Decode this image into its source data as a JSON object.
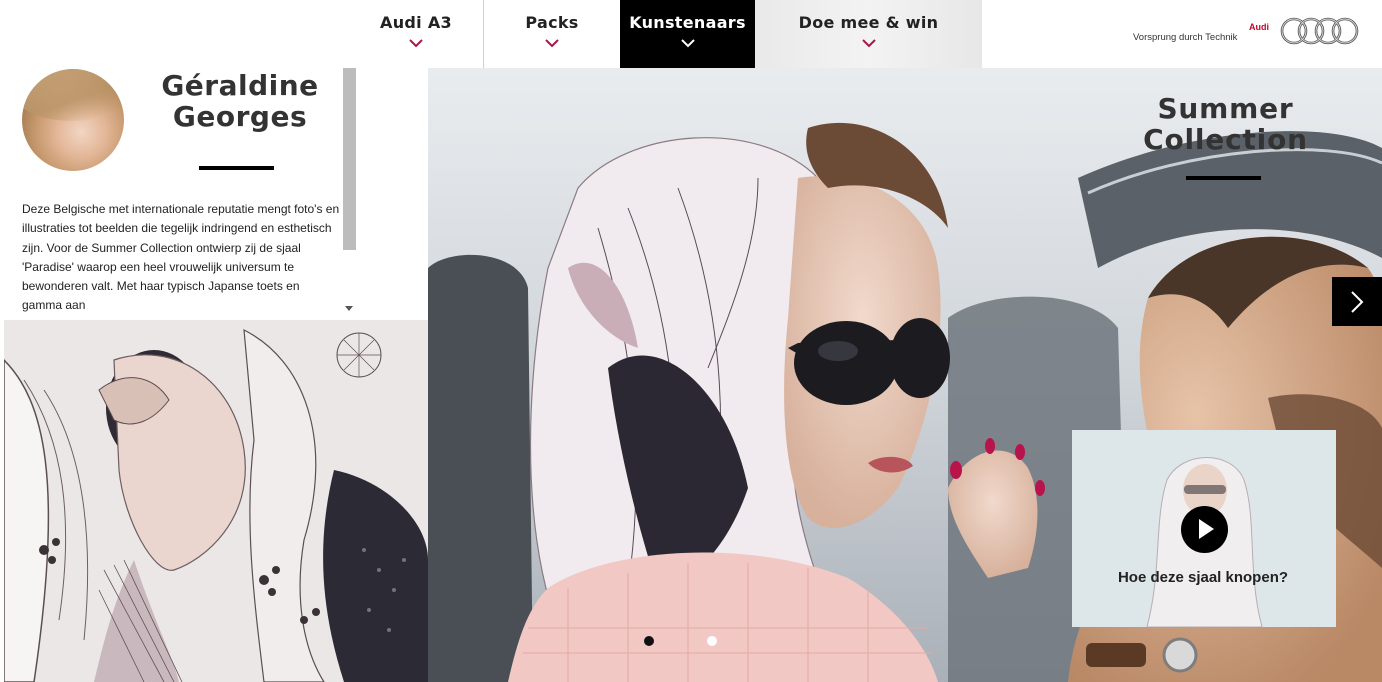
{
  "nav": {
    "items": [
      {
        "label": "Audi A3",
        "active": false
      },
      {
        "label": "Packs",
        "active": false
      },
      {
        "label": "Kunstenaars",
        "active": true
      },
      {
        "label": "Doe mee & win",
        "active": false
      }
    ]
  },
  "brand": {
    "name": "Audi",
    "slogan": "Vorsprung durch Technik",
    "accent_color": "#bb0a30"
  },
  "artist": {
    "name": "Géraldine Georges",
    "bio": "Deze Belgische met internationale reputatie mengt foto's en illustraties tot beelden die tegelijk indringend en esthetisch zijn. Voor de Summer Collection ontwierp zij de sjaal 'Paradise' waarop een heel vrouwelijk universum te bewonderen valt. Met haar typisch Japanse toets en gamma aan"
  },
  "hero": {
    "title": "Summer Collection",
    "video_caption": "Hoe deze sjaal knopen?",
    "slide_count": 2,
    "active_slide": 1
  },
  "icons": [
    "chevron-down-icon",
    "chevron-right-icon",
    "play-icon",
    "audi-rings-logo"
  ]
}
